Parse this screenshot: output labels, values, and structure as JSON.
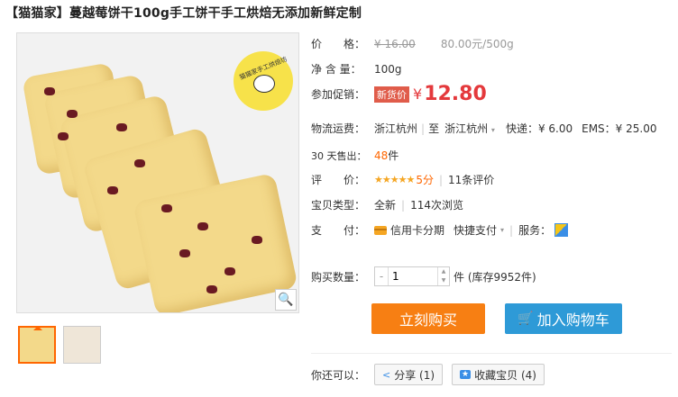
{
  "title": "【猫猫家】蔓越莓饼干100g手工饼干手工烘焙无添加新鲜定制",
  "badge_text": "猫猫家手工烘焙坊",
  "price_row": {
    "label": "价　　格：",
    "original": "¥ 16.00",
    "unit_price": "80.00元/500g"
  },
  "net_row": {
    "label": "净 含 量：",
    "value": "100g"
  },
  "promo_row": {
    "label": "参加促销：",
    "tag": "新货价",
    "yen": "¥",
    "price": "12.80"
  },
  "shipping_row": {
    "label": "物流运费：",
    "from": "浙江杭州",
    "to_label": "至",
    "to": "浙江杭州",
    "express": "快递：¥ 6.00",
    "ems": "EMS：¥ 25.00"
  },
  "sold_row": {
    "label": "30 天售出：",
    "value": "48",
    "unit": "件"
  },
  "rating_row": {
    "label": "评　　价：",
    "stars": "★★★★★",
    "score": "5分",
    "reviews": "11条评价"
  },
  "type_row": {
    "label": "宝贝类型：",
    "condition": "全新",
    "views": "114次浏览"
  },
  "pay_row": {
    "label": "支　　付：",
    "credit": "信用卡分期",
    "quick": "快捷支付",
    "service_label": "服务："
  },
  "qty_row": {
    "label": "购买数量：",
    "value": "1",
    "stock": "件 (库存9952件)"
  },
  "buttons": {
    "buy": "立刻购买",
    "cart": "加入购物车"
  },
  "share_row": {
    "label": "你还可以：",
    "share": "分享 (1)",
    "favorite": "收藏宝贝 (4)"
  },
  "colors": {
    "accent_orange": "#f77f13",
    "accent_blue": "#2e9ad7",
    "price_red": "#e4393c"
  }
}
